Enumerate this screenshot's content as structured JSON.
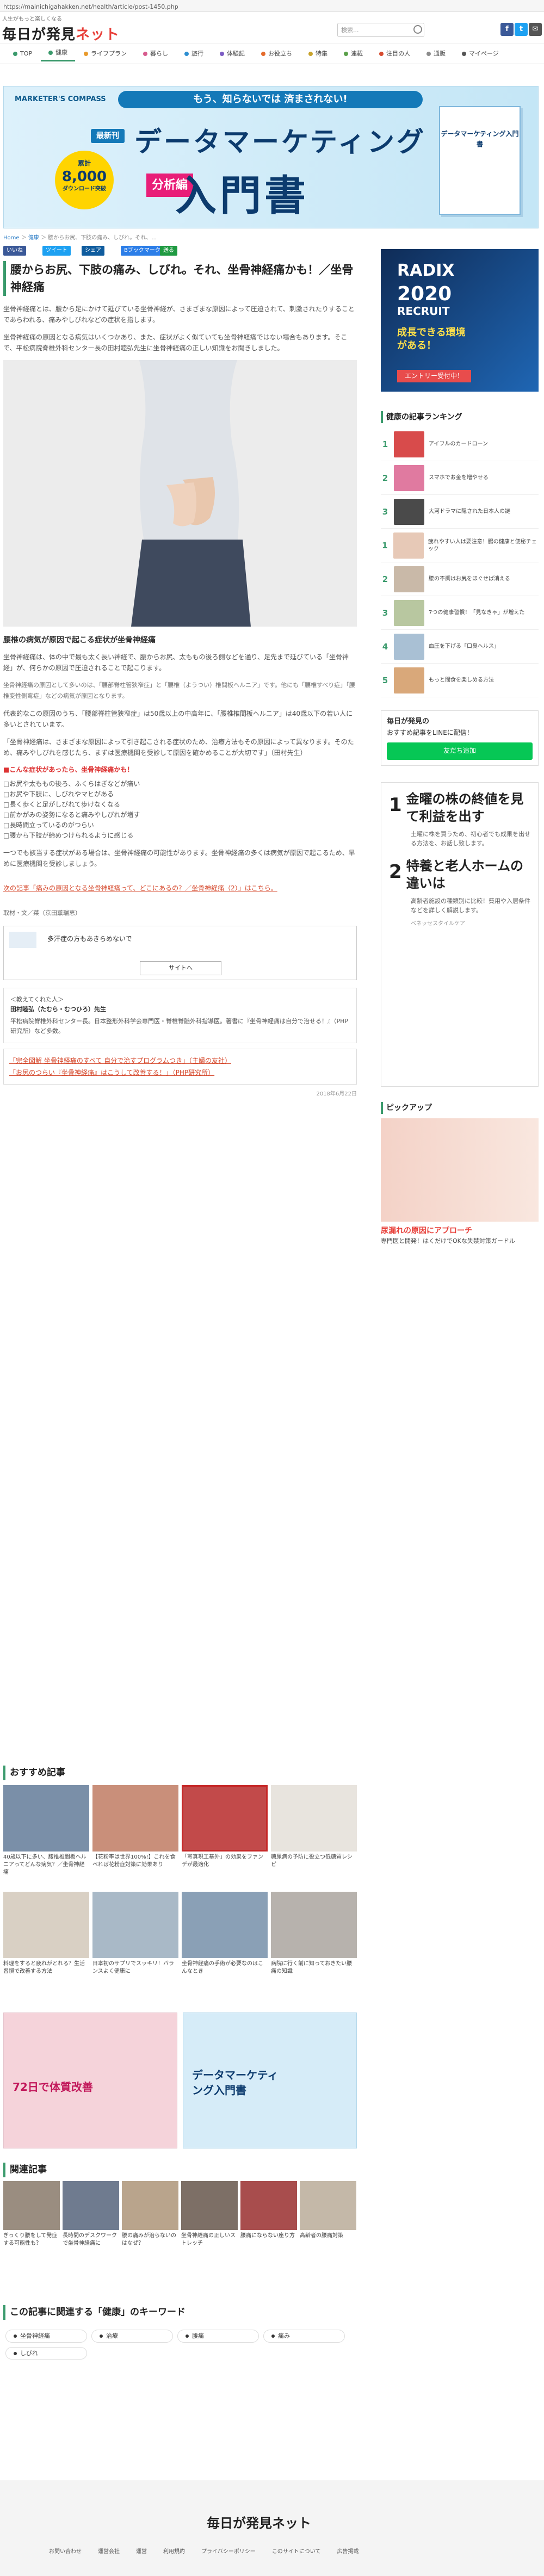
{
  "browser": {
    "url": "https://mainichigahakken.net/health/article/post-1450.php"
  },
  "header": {
    "tagline": "人生がもっと楽しくなる",
    "logo_main": "毎日が発見",
    "logo_accent": "ネット",
    "search_placeholder": "検索...",
    "social": [
      "f",
      "t",
      "✉"
    ]
  },
  "nav": [
    {
      "label": "TOP",
      "color": "#3a9a6c"
    },
    {
      "label": "健康",
      "color": "#3a9a6c"
    },
    {
      "label": "ライフプラン",
      "color": "#e89a2c"
    },
    {
      "label": "暮らし",
      "color": "#d75c8e"
    },
    {
      "label": "旅行",
      "color": "#2f8fd1"
    },
    {
      "label": "体験記",
      "color": "#7c5cc4"
    },
    {
      "label": "お役立ち",
      "color": "#e46b2c"
    },
    {
      "label": "特集",
      "color": "#c8a32c"
    },
    {
      "label": "連載",
      "color": "#5aa04a"
    },
    {
      "label": "注目の人",
      "color": "#d64b2f"
    },
    {
      "label": "通販",
      "color": "#8c8c8c"
    },
    {
      "label": "マイページ",
      "color": "#555555"
    }
  ],
  "ad_banner": {
    "brand": "MARKETER'S COMPASS",
    "catch": "もう、知らないでは 済まされない!",
    "new_label": "最新刊",
    "title_line1": "データマーケティング",
    "title_line2": "入門書",
    "tag": "分析編",
    "badge_l1": "累計",
    "badge_l2": "8,000",
    "badge_l3": "ダウンロード突破",
    "book_title": "データマーケティング入門書"
  },
  "breadcrumb": [
    "Home",
    "健康",
    "腰からお尻、下肢の痛み、しびれ。それ、..."
  ],
  "share_buttons": [
    {
      "label": "いいね",
      "color": "#3b5998"
    },
    {
      "label": "ツイート",
      "color": "#1da1f2"
    },
    {
      "label": "シェア",
      "color": "#0f5c9e"
    },
    {
      "label": "Bブックマーク",
      "color": "#2c7ee8"
    },
    {
      "label": "送る",
      "color": "#1f9a42"
    }
  ],
  "article": {
    "title": "腰からお尻、下肢の痛み、しびれ。それ、坐骨神経痛かも！／坐骨神経痛",
    "lead": [
      "坐骨神経痛とは、腰から足にかけて延びている坐骨神経が、さまざまな原因によって圧迫されて、刺激されたりすることであらわれる、痛みやしびれなどの症状を指します。",
      "坐骨神経痛の原因となる病気はいくつかあり、また、症状がよく似ていても坐骨神経痛ではない場合もあります。そこで、平松病院脊椎外科センター長の田村睦弘先生に坐骨神経痛の正しい知識をお聞きしました。"
    ],
    "subhead": "腰椎の病気が原因で起こる症状が坐骨神経痛",
    "paragraphs": [
      "坐骨神経痛は、体の中で最も太く長い神経で、腰からお尻、太ももの後ろ側などを通り、足先まで延びている「坐骨神経」が、何らかの原因で圧迫されることで起こります。",
      "坐骨神経痛の原因として多いのは、「腰部脊柱管狭窄症」と「腰椎（ようつい）椎間板ヘルニア」です。他にも「腰椎すべり症」「腰椎変性側弯症」などの病気が原因となります。",
      "代表的なこの原因のうち、「腰部脊柱管狭窄症」は50歳以上の中高年に、「腰椎椎間板ヘルニア」は40歳以下の若い人に多いとされています。",
      "「坐骨神経痛は、さまざまな原因によって引き起こされる症状のため、治療方法もその原因によって異なります。そのため、痛みやしびれを感じたら、まずは医療機関を受診して原因を確かめることが大切です」（田村先生）"
    ],
    "question": "■こんな症状があったら、坐骨神経痛かも！",
    "checklist": [
      "□お尻や太ももの後ろ、ふくらはぎなどが痛い",
      "□お尻や下肢に、しびれやマヒがある",
      "□長く歩くと足がしびれて歩けなくなる",
      "□前かがみの姿勢になると痛みやしびれが増す",
      "□長時間立っているのがつらい",
      "□腰から下肢が締めつけられるように感じる"
    ],
    "after_list": "一つでも該当する症状がある場合は、坐骨神経痛の可能性があります。坐骨神経痛の多くは病気が原因で起こるため、早めに医療機関を受診しましょう。",
    "link": "次の記事「痛みの原因となる坐骨神経痛って、どこにあるの？／坐骨神経痛（2）」はこちら。",
    "byline": "取材・文／菜（京田薫瑞恵）",
    "inline_ad_text": "多汗症の方もあきらめないで",
    "inline_ad_sub": "サイトへ",
    "expert_label": "＜教えてくれた人＞",
    "expert_name": "田村睦弘（たむら・むつひろ）先生",
    "expert_bio": "平松病院脊椎外科センター長。日本整形外科学会専門医・脊椎脊髄外科指導医。著書に『坐骨神経痛は自分で治せる！』（PHP研究所）など多数。",
    "related_links": [
      "「完全図解 坐骨神経痛のすべて 自分で治すプログラムつき」（主婦の友社）",
      "「お尻のつらい『坐骨神経痛』はこうして改善する！」（PHP研究所）"
    ],
    "date": "2018年6月22日"
  },
  "recommend": {
    "title": "おすすめ記事",
    "cards": [
      {
        "caption": "40歳以下に多い、腰椎椎間板ヘルニアってどんな病気？／坐骨神経痛",
        "color": "#7a8fa8"
      },
      {
        "caption": "【花粉率は世界100%!】これを食べれば花粉症対策に効果あり",
        "color": "#c98f7a"
      },
      {
        "caption": "「写真現工基外」の効果をファンデが最適化",
        "color": "#c24a4a"
      },
      {
        "caption": "糖尿病の予防に役立つ低糖質レシピ",
        "color": "#e8e4de"
      },
      {
        "caption": "料理をすると疲れがとれる？生活習慣で改善する方法",
        "color": "#d9d0c4"
      },
      {
        "caption": "日本初のサプリでスッキリ！バランスよく健康に",
        "color": "#a9b9c7"
      },
      {
        "caption": "坐骨神経痛の手術が必要なのはこんなとき",
        "color": "#8aa0b6"
      },
      {
        "caption": "病院に行く前に知っておきたい腰痛の知識",
        "color": "#b7b2ad"
      }
    ]
  },
  "bottom_ads": [
    {
      "title": "72日で体質改善",
      "color": "#f5d3da"
    },
    {
      "title": "データマーケティング入門書",
      "color": "#d6ecf8"
    }
  ],
  "related": {
    "title": "関連記事",
    "items": [
      {
        "caption": "ぎっくり腰をして発症する可能性も？",
        "color": "#9a8d80"
      },
      {
        "caption": "長時間のデスクワークで坐骨神経痛に",
        "color": "#6f7b8f"
      },
      {
        "caption": "腰の痛みが治らないのはなぜ？",
        "color": "#b9a48c"
      },
      {
        "caption": "坐骨神経痛の正しいストレッチ",
        "color": "#7d6f66"
      },
      {
        "caption": "腰痛にならない座り方",
        "color": "#a84d4d"
      },
      {
        "caption": "高齢者の腰痛対策",
        "color": "#c4b8a8"
      }
    ]
  },
  "keywords": {
    "title": "この記事に関連する「健康」のキーワード",
    "items": [
      "坐骨神経痛",
      "治療",
      "腰痛",
      "痛み",
      "しびれ"
    ]
  },
  "sidebar": {
    "ad_top": {
      "brand": "RADIX",
      "year": "2020",
      "recruit": "RECRUIT",
      "catch": "成長できる環境がある！",
      "cta": "エントリー受付中！"
    },
    "ranking_title": "健康の記事ランキング",
    "ranking": [
      {
        "no": "1",
        "title": "アイフルのカードローン",
        "color": "#d84b4b"
      },
      {
        "no": "2",
        "title": "スマホでお金を増やせる",
        "color": "#e07aa0"
      },
      {
        "no": "3",
        "title": "大河ドラマに隠された日本人の謎",
        "color": "#4a4a4a"
      },
      {
        "no": "1",
        "title": "疲れやすい人は要注意！腸の健康と便秘チェック",
        "color": "#e7c9b7"
      },
      {
        "no": "2",
        "title": "腰の不調はお尻をほぐせば消える",
        "color": "#c9b9a8"
      },
      {
        "no": "3",
        "title": "7つの健康習慣！「見なきゃ」が増えた",
        "color": "#b8c7a0"
      },
      {
        "no": "4",
        "title": "血圧を下げる「口臭ヘルス」",
        "color": "#a9c0d4"
      },
      {
        "no": "5",
        "title": "もっと間食を楽しめる方法",
        "color": "#d9a87a"
      }
    ],
    "line_title": "毎日が発見の",
    "line_sub": "おすすめ記事をLINEに配信！",
    "line_cta": "友だち追加",
    "ad_mid": {
      "num1": "1",
      "head1": "金曜の株の終値を見て利益を出す",
      "body1": "土曜に株を買うため、初心者でも成果を出せる方法を、お話し致します。",
      "num2": "2",
      "head2": "特養と老人ホームの違いは",
      "body2": "高齢者施設の種類別に比較！費用や入居条件などを詳しく解説します。",
      "src": "ベネッセスタイルケア"
    },
    "pickup_title": "ピックアップ",
    "pickup_caption": "尿漏れの原因にアプローチ",
    "pickup_sub": "専門医と開発！はくだけでOKな失禁対策ガードル"
  },
  "footer": {
    "logo": "毎日が発見ネット",
    "links": [
      "お問い合わせ",
      "運営会社",
      "運営",
      "利用規約",
      "プライバシーポリシー",
      "このサイトについて",
      "広告掲載"
    ]
  }
}
